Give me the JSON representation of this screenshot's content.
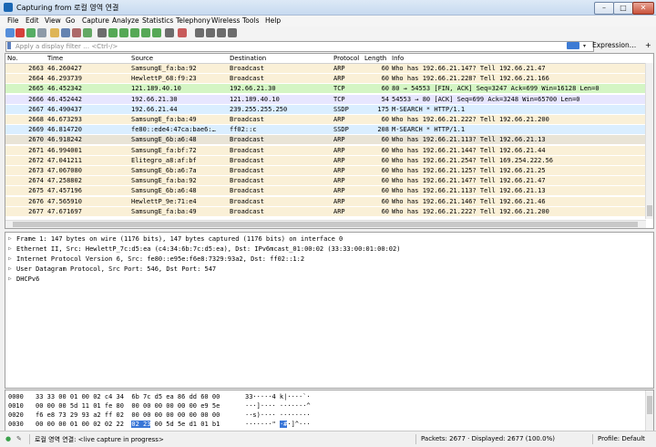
{
  "window": {
    "title": "Capturing from 로컬 영역 연결",
    "minimize": "–",
    "maximize": "□",
    "close": "✕"
  },
  "menu": [
    "File",
    "Edit",
    "View",
    "Go",
    "Capture",
    "Analyze",
    "Statistics",
    "Telephony",
    "Wireless",
    "Tools",
    "Help"
  ],
  "toolbar": {
    "icons": [
      {
        "name": "shark-fin-start-icon",
        "color": "#3a7bd5"
      },
      {
        "name": "stop-capture-icon",
        "color": "#d0201a"
      },
      {
        "name": "restart-capture-icon",
        "color": "#3aa04a"
      },
      {
        "name": "capture-options-icon",
        "color": "#7a8a9a"
      },
      {
        "name": "open-file-icon",
        "color": "#d9a93a"
      },
      {
        "name": "save-file-icon",
        "color": "#4a6fa5"
      },
      {
        "name": "close-file-icon",
        "color": "#a05050"
      },
      {
        "name": "reload-icon",
        "color": "#4a9a4a"
      },
      {
        "name": "find-packet-icon",
        "color": "#555555"
      },
      {
        "name": "go-back-icon",
        "color": "#3a9a3a"
      },
      {
        "name": "go-forward-icon",
        "color": "#3a9a3a"
      },
      {
        "name": "go-to-packet-icon",
        "color": "#3a9a3a"
      },
      {
        "name": "first-packet-icon",
        "color": "#3a9a3a"
      },
      {
        "name": "last-packet-icon",
        "color": "#3a9a3a"
      },
      {
        "name": "autoscroll-icon",
        "color": "#555555"
      },
      {
        "name": "colorize-icon",
        "color": "#c04040"
      },
      {
        "name": "zoom-in-icon",
        "color": "#555555"
      },
      {
        "name": "zoom-out-icon",
        "color": "#555555"
      },
      {
        "name": "zoom-normal-icon",
        "color": "#555555"
      },
      {
        "name": "resize-columns-icon",
        "color": "#555555"
      }
    ]
  },
  "filter": {
    "placeholder": "Apply a display filter … <Ctrl-/>",
    "expression_label": "Expression…",
    "add_label": "+"
  },
  "packet_list": {
    "columns": [
      "No.",
      "Time",
      "Source",
      "Destination",
      "Protocol",
      "Length",
      "Info"
    ],
    "rows": [
      {
        "no": "2663",
        "time": "46.260427",
        "src": "SamsungE_fa:ba:92",
        "dst": "Broadcast",
        "proto": "ARP",
        "len": "60",
        "info": "Who has 192.66.21.147? Tell 192.66.21.47",
        "bg": "#faf0d7"
      },
      {
        "no": "2664",
        "time": "46.293739",
        "src": "HewlettP_68:f9:23",
        "dst": "Broadcast",
        "proto": "ARP",
        "len": "60",
        "info": "Who has 192.66.21.228? Tell 192.66.21.166",
        "bg": "#faf0d7"
      },
      {
        "no": "2665",
        "time": "46.452342",
        "src": "121.189.40.10",
        "dst": "192.66.21.30",
        "proto": "TCP",
        "len": "60",
        "info": "80 → 54553 [FIN, ACK] Seq=3247 Ack=699 Win=16128 Len=0",
        "bg": "#d4f5c4"
      },
      {
        "no": "2666",
        "time": "46.452442",
        "src": "192.66.21.30",
        "dst": "121.189.40.10",
        "proto": "TCP",
        "len": "54",
        "info": "54553 → 80 [ACK] Seq=699 Ack=3248 Win=65700 Len=0",
        "bg": "#e7e6ff"
      },
      {
        "no": "2667",
        "time": "46.490437",
        "src": "192.66.21.44",
        "dst": "239.255.255.250",
        "proto": "SSDP",
        "len": "175",
        "info": "M-SEARCH * HTTP/1.1",
        "bg": "#daeeff"
      },
      {
        "no": "2668",
        "time": "46.673293",
        "src": "SamsungE_fa:ba:49",
        "dst": "Broadcast",
        "proto": "ARP",
        "len": "60",
        "info": "Who has 192.66.21.222? Tell 192.66.21.200",
        "bg": "#faf0d7"
      },
      {
        "no": "2669",
        "time": "46.814720",
        "src": "fe80::ede4:47ca:bae6:…",
        "dst": "ff02::c",
        "proto": "SSDP",
        "len": "208",
        "info": "M-SEARCH * HTTP/1.1",
        "bg": "#daeeff"
      },
      {
        "no": "2670",
        "time": "46.918242",
        "src": "SamsungE_6b:a6:48",
        "dst": "Broadcast",
        "proto": "ARP",
        "len": "60",
        "info": "Who has 192.66.21.113? Tell 192.66.21.13",
        "bg": "#e9e4d6"
      },
      {
        "no": "2671",
        "time": "46.994001",
        "src": "SamsungE_fa:bf:72",
        "dst": "Broadcast",
        "proto": "ARP",
        "len": "60",
        "info": "Who has 192.66.21.144? Tell 192.66.21.44",
        "bg": "#faf0d7"
      },
      {
        "no": "2672",
        "time": "47.041211",
        "src": "Elitegro_a8:af:bf",
        "dst": "Broadcast",
        "proto": "ARP",
        "len": "60",
        "info": "Who has 192.66.21.254? Tell 169.254.222.56",
        "bg": "#faf0d7"
      },
      {
        "no": "2673",
        "time": "47.067080",
        "src": "SamsungE_6b:a6:7a",
        "dst": "Broadcast",
        "proto": "ARP",
        "len": "60",
        "info": "Who has 192.66.21.125? Tell 192.66.21.25",
        "bg": "#faf0d7"
      },
      {
        "no": "2674",
        "time": "47.258802",
        "src": "SamsungE_fa:ba:92",
        "dst": "Broadcast",
        "proto": "ARP",
        "len": "60",
        "info": "Who has 192.66.21.147? Tell 192.66.21.47",
        "bg": "#faf0d7"
      },
      {
        "no": "2675",
        "time": "47.457196",
        "src": "SamsungE_6b:a6:48",
        "dst": "Broadcast",
        "proto": "ARP",
        "len": "60",
        "info": "Who has 192.66.21.113? Tell 192.66.21.13",
        "bg": "#faf0d7"
      },
      {
        "no": "2676",
        "time": "47.565910",
        "src": "HewlettP_9e:71:e4",
        "dst": "Broadcast",
        "proto": "ARP",
        "len": "60",
        "info": "Who has 192.66.21.146? Tell 192.66.21.46",
        "bg": "#faf0d7"
      },
      {
        "no": "2677",
        "time": "47.671697",
        "src": "SamsungE_fa:ba:49",
        "dst": "Broadcast",
        "proto": "ARP",
        "len": "60",
        "info": "Who has 192.66.21.222? Tell 192.66.21.200",
        "bg": "#faf0d7"
      }
    ]
  },
  "details": [
    "Frame 1: 147 bytes on wire (1176 bits), 147 bytes captured (1176 bits) on interface 0",
    "Ethernet II, Src: HewlettP_7c:d5:ea (c4:34:6b:7c:d5:ea), Dst: IPv6mcast_01:00:02 (33:33:00:01:00:02)",
    "Internet Protocol Version 6, Src: fe80::e95e:f6e8:7329:93a2, Dst: ff02::1:2",
    "User Datagram Protocol, Src Port: 546, Dst Port: 547",
    "DHCPv6"
  ],
  "bytes": [
    {
      "offset": "0000",
      "hex": "33 33 00 01 00 02 c4 34  6b 7c d5 ea 86 dd 60 00",
      "ascii": "33·····4 k|····`·"
    },
    {
      "offset": "0010",
      "hex": "00 00 00 5d 11 01 fe 80  00 00 00 00 00 00 e9 5e",
      "ascii": "···]···· ·······^"
    },
    {
      "offset": "0020",
      "hex": "f6 e8 73 29 93 a2 ff 02  00 00 00 00 00 00 00 00",
      "ascii": "··s)···· ········"
    },
    {
      "offset": "0030",
      "hex_pre": "00 00 00 01 00 02 02 22  ",
      "hex_hl": "02 23",
      "hex_post": " 00 5d 5e d1 01 b1",
      "ascii_pre": "·······\" ",
      "ascii_hl": "·#",
      "ascii_post": "·]^···"
    }
  ],
  "status": {
    "ready_icon": "●",
    "interface": "로컬 영역 연결: <live capture in progress>",
    "packets": "Packets: 2677 · Displayed: 2677 (100.0%)",
    "profile": "Profile: Default"
  },
  "colors": {
    "arp": "#faf0d7",
    "tcp_green": "#d4f5c4",
    "tcp_purple": "#e7e6ff",
    "ssdp": "#daeeff",
    "selection": "#3875d7"
  }
}
